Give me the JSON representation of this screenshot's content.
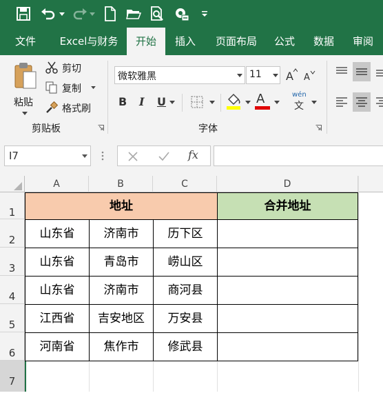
{
  "tabs": [
    "文件",
    "Excel与财务",
    "开始",
    "插入",
    "页面布局",
    "公式",
    "数据",
    "审阅"
  ],
  "clipboard": {
    "paste": "粘贴",
    "cut": "剪切",
    "copy": "复制",
    "format_painter": "格式刷",
    "group": "剪贴板"
  },
  "font": {
    "name": "微软雅黑",
    "size": "11",
    "group": "字体",
    "bold": "B",
    "italic": "I",
    "underline": "U",
    "color_letter": "A",
    "wen": "wén",
    "wen_char": "文"
  },
  "formula_bar": {
    "name_box": "I7",
    "fx": "fx",
    "value": ""
  },
  "columns": [
    "A",
    "B",
    "C",
    "D"
  ],
  "rows": [
    "1",
    "2",
    "3",
    "4",
    "5",
    "6",
    "7"
  ],
  "sheet": {
    "header_address": "地址",
    "header_merged": "合并地址",
    "data": [
      [
        "山东省",
        "济南市",
        "历下区"
      ],
      [
        "山东省",
        "青岛市",
        "崂山区"
      ],
      [
        "山东省",
        "济南市",
        "商河县"
      ],
      [
        "江西省",
        "吉安地区",
        "万安县"
      ],
      [
        "河南省",
        "焦作市",
        "修武县"
      ]
    ]
  },
  "colors": {
    "excel_green": "#217346",
    "address_header": "#f8cbad",
    "merged_header": "#c6e0b4",
    "font_color_bar": "#e00000",
    "highlight_bar": "#ffff00"
  }
}
